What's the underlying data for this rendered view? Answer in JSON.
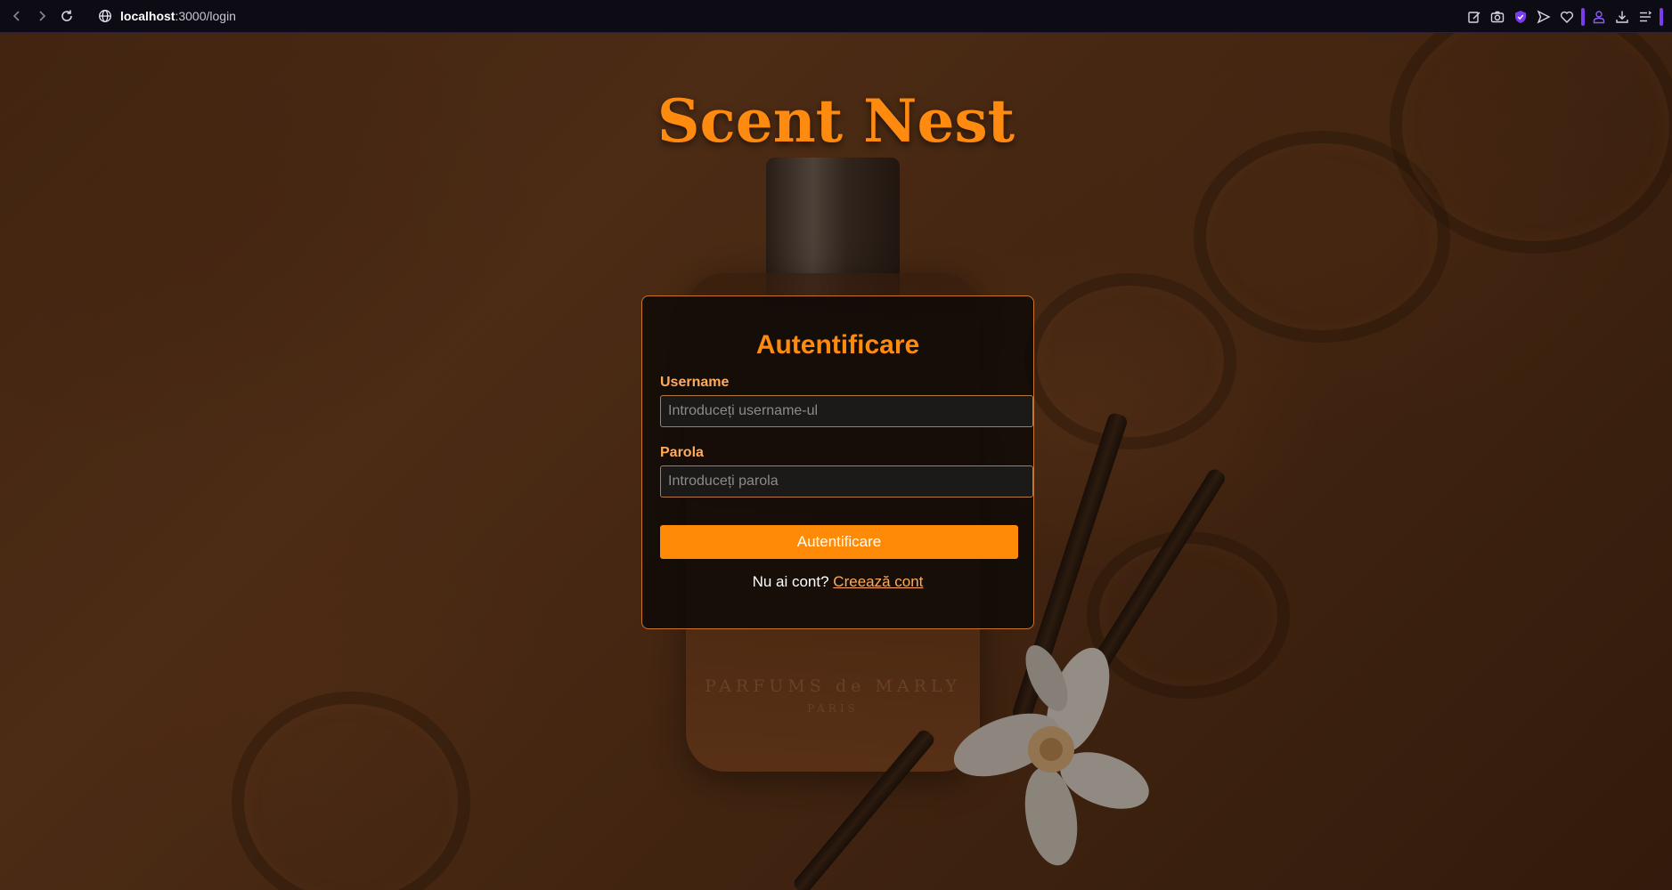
{
  "browser": {
    "url_host": "localhost",
    "url_path": ":3000/login",
    "icons": [
      "back-icon",
      "forward-icon",
      "reload-icon",
      "globe-icon",
      "edit-icon",
      "camera-icon",
      "shield-icon",
      "send-icon",
      "heart-icon",
      "profile-icon",
      "download-icon",
      "menu-icon"
    ],
    "accent_color": "#7b3cf0"
  },
  "page": {
    "site_title": "Scent Nest",
    "bottle_engraving": "PARFUMS de MARLY",
    "bottle_engraving_sub": "PARIS"
  },
  "login": {
    "heading": "Autentificare",
    "username_label": "Username",
    "username_placeholder": "Introduceți username-ul",
    "password_label": "Parola",
    "password_placeholder": "Introduceți parola",
    "submit_label": "Autentificare",
    "register_prompt": "Nu ai cont?",
    "register_link": "Creează cont"
  },
  "colors": {
    "brand_orange": "#ff8a10",
    "label_orange": "#ffab5c",
    "card_border": "#c9762a"
  }
}
